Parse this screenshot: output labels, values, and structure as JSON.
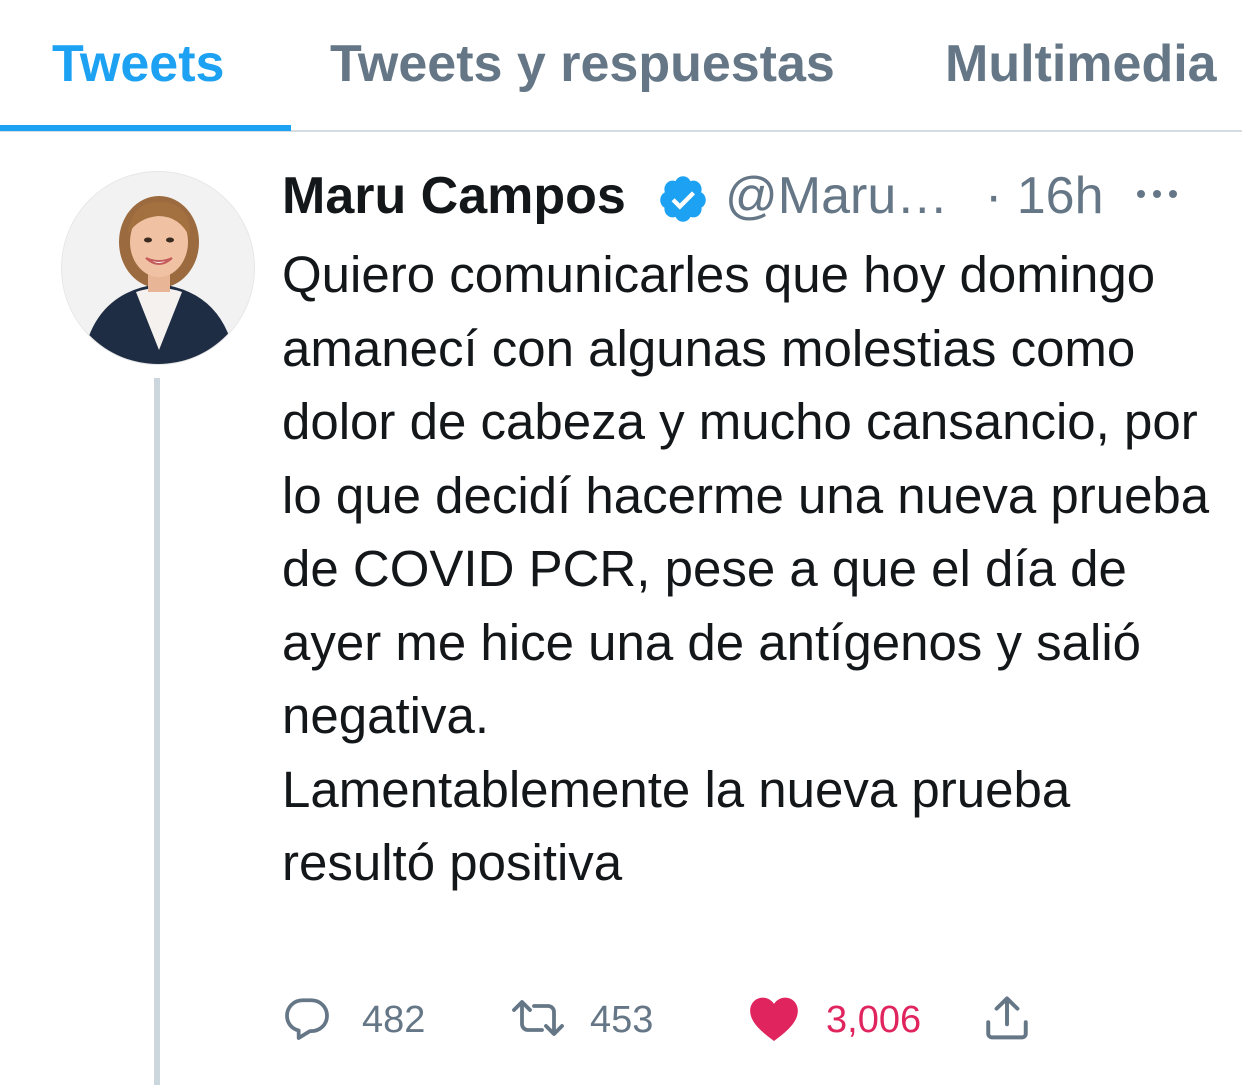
{
  "tabs": [
    {
      "label": "Tweets",
      "active": true
    },
    {
      "label": "Tweets y respuestas",
      "active": false
    },
    {
      "label": "Multimedia",
      "active": false
    }
  ],
  "tweet": {
    "author_name": "Maru Campos",
    "verified": true,
    "handle": "@Maru…",
    "time": "· 16h",
    "text": "Quiero comunicarles que hoy domingo amanecí con algunas molestias como dolor de cabeza y mucho cansancio, por lo que decidí hacerme una nueva prueba de COVID PCR, pese a que el día de ayer me hice una de antígenos y salió negativa.\nLamentablemente la nueva prueba resultó positiva",
    "actions": {
      "replies": "482",
      "retweets": "453",
      "likes": "3,006"
    },
    "liked": true
  },
  "icons": {
    "reply": "reply-icon",
    "retweet": "retweet-icon",
    "like": "heart-icon",
    "share": "share-icon",
    "more": "more-icon",
    "verified": "verified-badge-icon"
  },
  "colors": {
    "accent": "#1da1f2",
    "secondary_text": "#657786",
    "primary_text": "#14171a",
    "like": "#e0245e",
    "divider": "#d5dde3",
    "thread_line": "#ccd6dd"
  }
}
